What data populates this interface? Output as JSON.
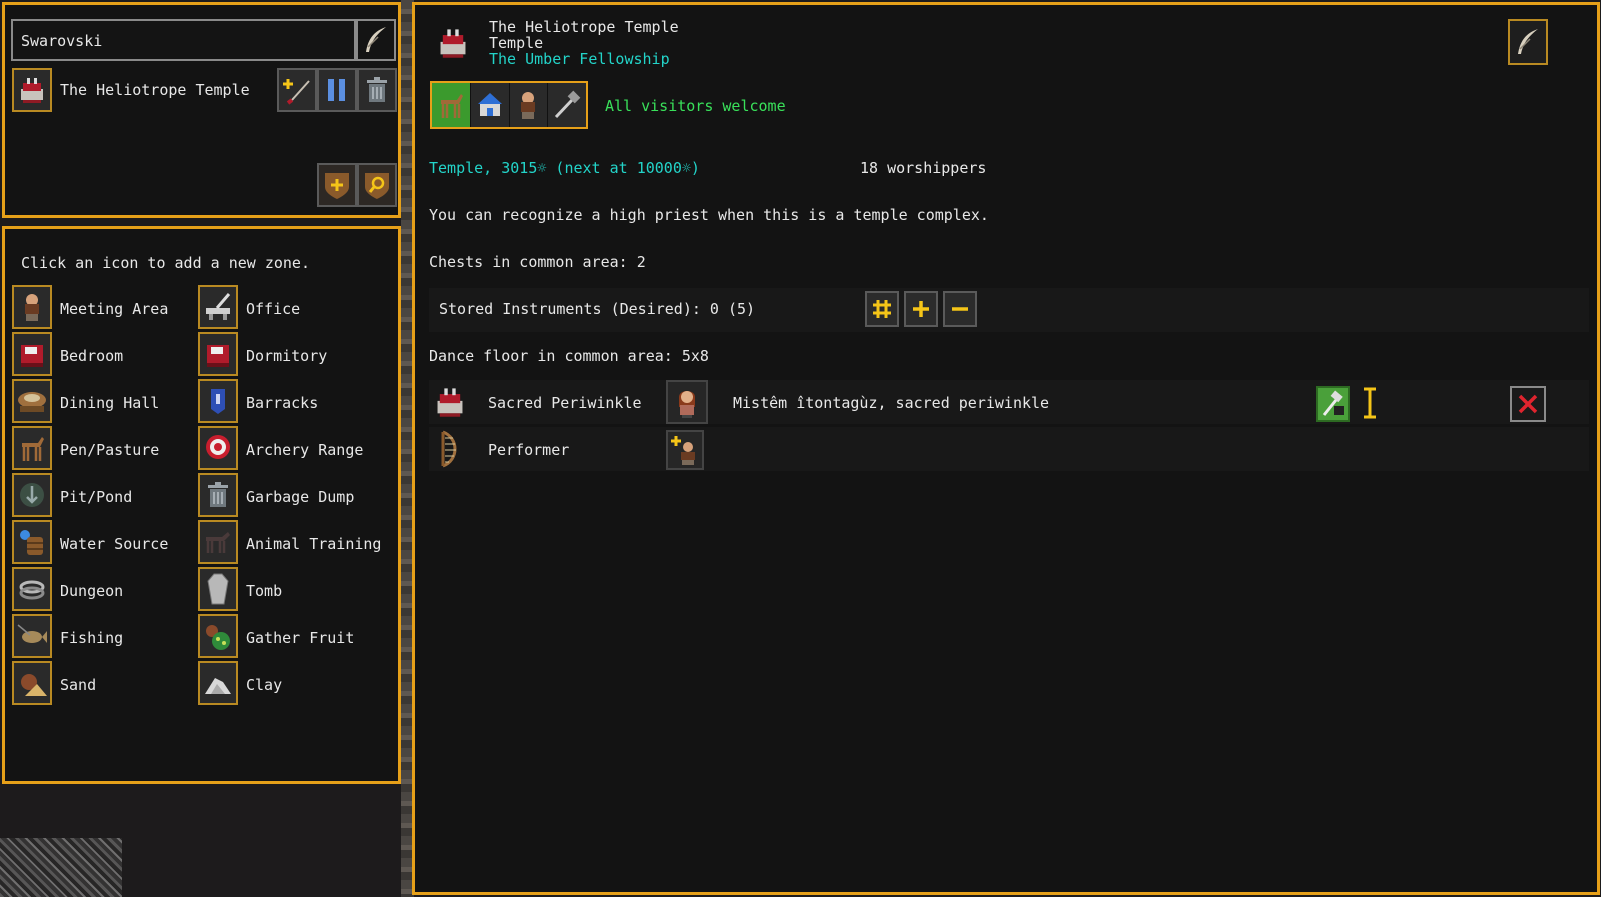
{
  "top_left": {
    "name_value": "Swarovski",
    "zone_label": "The Heliotrope Temple"
  },
  "zone_list": {
    "instruction": "Click an icon to add a new zone.",
    "left_items": [
      "Meeting Area",
      "Bedroom",
      "Dining Hall",
      "Pen/Pasture",
      "Pit/Pond",
      "Water Source",
      "Dungeon",
      "Fishing",
      "Sand"
    ],
    "right_items": [
      "Office",
      "Dormitory",
      "Barracks",
      "Archery Range",
      "Garbage Dump",
      "Animal Training",
      "Tomb",
      "Gather Fruit",
      "Clay"
    ]
  },
  "detail": {
    "title_line1": "The Heliotrope Temple",
    "title_line2": "Temple",
    "owner": "The Umber Fellowship",
    "access_text": "All visitors welcome",
    "temple_value": "Temple, 3015☼ (next at 10000☼)",
    "worshippers": "18 worshippers",
    "recognize_text": "You can recognize a high priest when this is a temple complex.",
    "chests_text": "Chests in common area: 2",
    "instruments_text": "Stored Instruments (Desired): 0 (5)",
    "dance_text": "Dance floor in common area: 5x8",
    "positions": [
      {
        "role": "Sacred Periwinkle",
        "holder": "Mistêm îtontagùz, sacred periwinkle"
      },
      {
        "role": "Performer",
        "holder": ""
      }
    ]
  },
  "colors": {
    "border": "#e6a019",
    "cyan": "#23d4c9",
    "green": "#39e05a",
    "panel_bg": "#131313"
  },
  "icons": {
    "temple": "temple-icon",
    "pen": "quill-icon",
    "trash": "trash-icon",
    "pause": "pause-icon"
  }
}
